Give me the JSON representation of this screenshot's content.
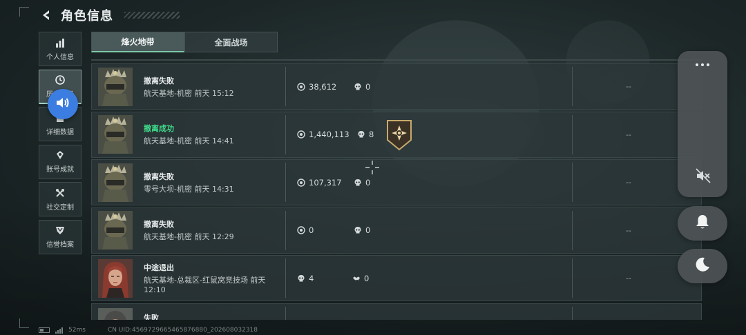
{
  "header": {
    "title": "角色信息"
  },
  "sidebar": {
    "items": [
      {
        "label": "个人信息",
        "icon": "bar-chart-icon"
      },
      {
        "label": "历史记录",
        "icon": "history-clock-icon"
      },
      {
        "label": "详细数据",
        "icon": "document-icon"
      },
      {
        "label": "账号成就",
        "icon": "achievement-icon"
      },
      {
        "label": "社交定制",
        "icon": "tools-icon"
      },
      {
        "label": "信誉档案",
        "icon": "shield-icon"
      }
    ]
  },
  "tabs": [
    {
      "label": "烽火地带",
      "active": true
    },
    {
      "label": "全面战场",
      "active": false
    }
  ],
  "records": [
    {
      "status": "撤离失败",
      "status_type": "fail",
      "location": "航天基地-机密 前天 15:12",
      "value": "38,612",
      "kills": "0",
      "extra": "--",
      "avatar": "male-helmet",
      "badge": false
    },
    {
      "status": "撤离成功",
      "status_type": "success",
      "location": "航天基地-机密 前天 14:41",
      "value": "1,440,113",
      "kills": "8",
      "extra": "--",
      "avatar": "male-helmet",
      "badge": true
    },
    {
      "status": "撤离失败",
      "status_type": "fail",
      "location": "零号大坝-机密 前天 14:31",
      "value": "107,317",
      "kills": "0",
      "extra": "--",
      "avatar": "male-helmet",
      "badge": false
    },
    {
      "status": "撤离失败",
      "status_type": "fail",
      "location": "航天基地-机密 前天 12:29",
      "value": "0",
      "kills": "0",
      "extra": "--",
      "avatar": "male-helmet",
      "badge": false
    },
    {
      "status": "中途退出",
      "status_type": "fail",
      "location": "航天基地-总裁区-红鼠窝竞技场 前天 12:10",
      "value": "4",
      "kills": "0",
      "extra": "--",
      "avatar": "female",
      "badge": false,
      "first_icon": "skull-icon",
      "second_icon": "handshake-icon"
    },
    {
      "status": "失败",
      "status_type": "fail",
      "location": "",
      "value": "",
      "kills": "",
      "extra": "",
      "avatar": "male-partial",
      "badge": false
    }
  ],
  "footer": {
    "ping": "52ms",
    "uid": "CN UID:4569729665465876880_202608032318"
  },
  "colors": {
    "accent": "#3fdc8a",
    "speaker": "#3b7de0",
    "panel": "#4e5456"
  }
}
